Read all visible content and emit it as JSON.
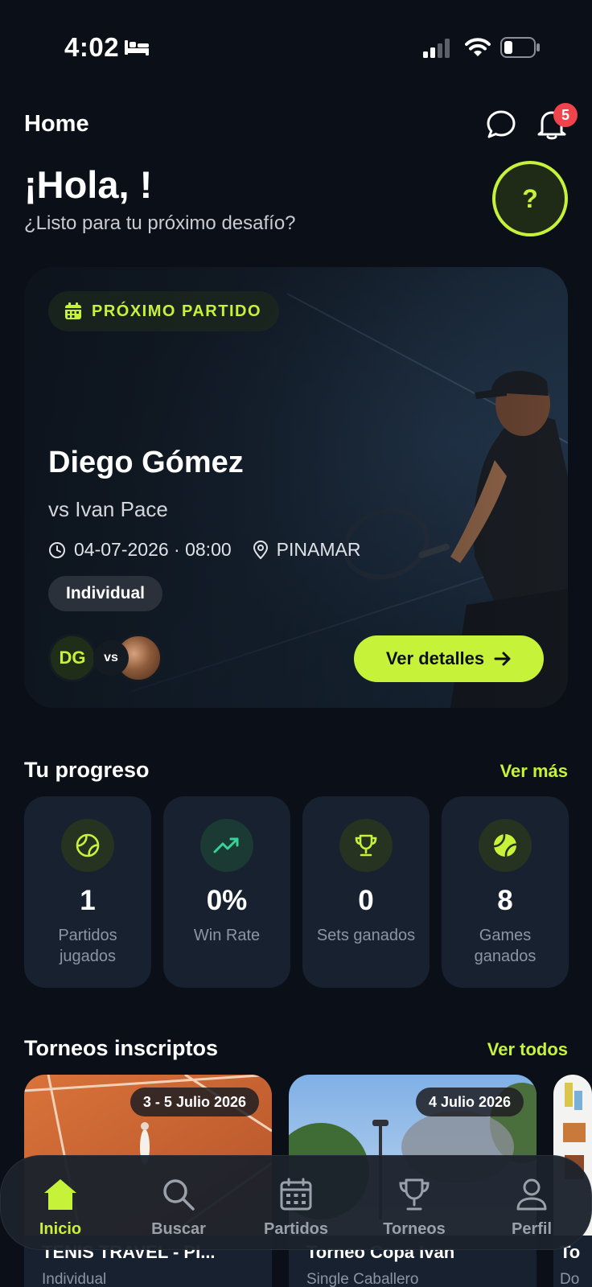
{
  "status_bar": {
    "time": "4:02"
  },
  "header": {
    "title": "Home",
    "notifications_count": "5",
    "help_label": "?"
  },
  "greeting": {
    "title": "¡Hola, !",
    "subtitle": "¿Listo para tu próximo desafío?"
  },
  "next_match": {
    "tag": "PRÓXIMO PARTIDO",
    "player": "Diego Gómez",
    "opponent": "vs Ivan Pace",
    "datetime": "04-07-2026 · 08:00",
    "location": "PINAMAR",
    "type": "Individual",
    "player_initials": "DG",
    "vs_label": "vs",
    "details_label": "Ver detalles"
  },
  "progress": {
    "title": "Tu progreso",
    "link": "Ver más",
    "stats": [
      {
        "value": "1",
        "label": "Partidos jugados",
        "icon": "tennis-ball-outline-icon",
        "color": "#c6f23a"
      },
      {
        "value": "0%",
        "label": "Win Rate",
        "icon": "trending-up-icon",
        "color": "#34d399"
      },
      {
        "value": "0",
        "label": "Sets ganados",
        "icon": "trophy-icon",
        "color": "#c6f23a"
      },
      {
        "value": "8",
        "label": "Games ganados",
        "icon": "tennis-ball-icon",
        "color": "#c6f23a"
      }
    ]
  },
  "tournaments": {
    "title": "Torneos inscriptos",
    "link": "Ver todos",
    "items": [
      {
        "date": "3 - 5 Julio 2026",
        "name": "TENIS TRAVEL - PI...",
        "type": "Individual"
      },
      {
        "date": "4 Julio 2026",
        "name": "Torneo Copa Ivan",
        "type": "Single Caballero"
      },
      {
        "date": "",
        "name": "To",
        "type": "Do"
      }
    ]
  },
  "nav": {
    "items": [
      {
        "label": "Inicio",
        "icon": "home-icon",
        "active": true
      },
      {
        "label": "Buscar",
        "icon": "search-icon"
      },
      {
        "label": "Partidos",
        "icon": "calendar-icon"
      },
      {
        "label": "Torneos",
        "icon": "trophy-icon"
      },
      {
        "label": "Perfil",
        "icon": "user-icon"
      }
    ]
  },
  "colors": {
    "accent": "#c6f23a",
    "background": "#0b1018",
    "card": "#172130",
    "badge": "#f0434c"
  }
}
